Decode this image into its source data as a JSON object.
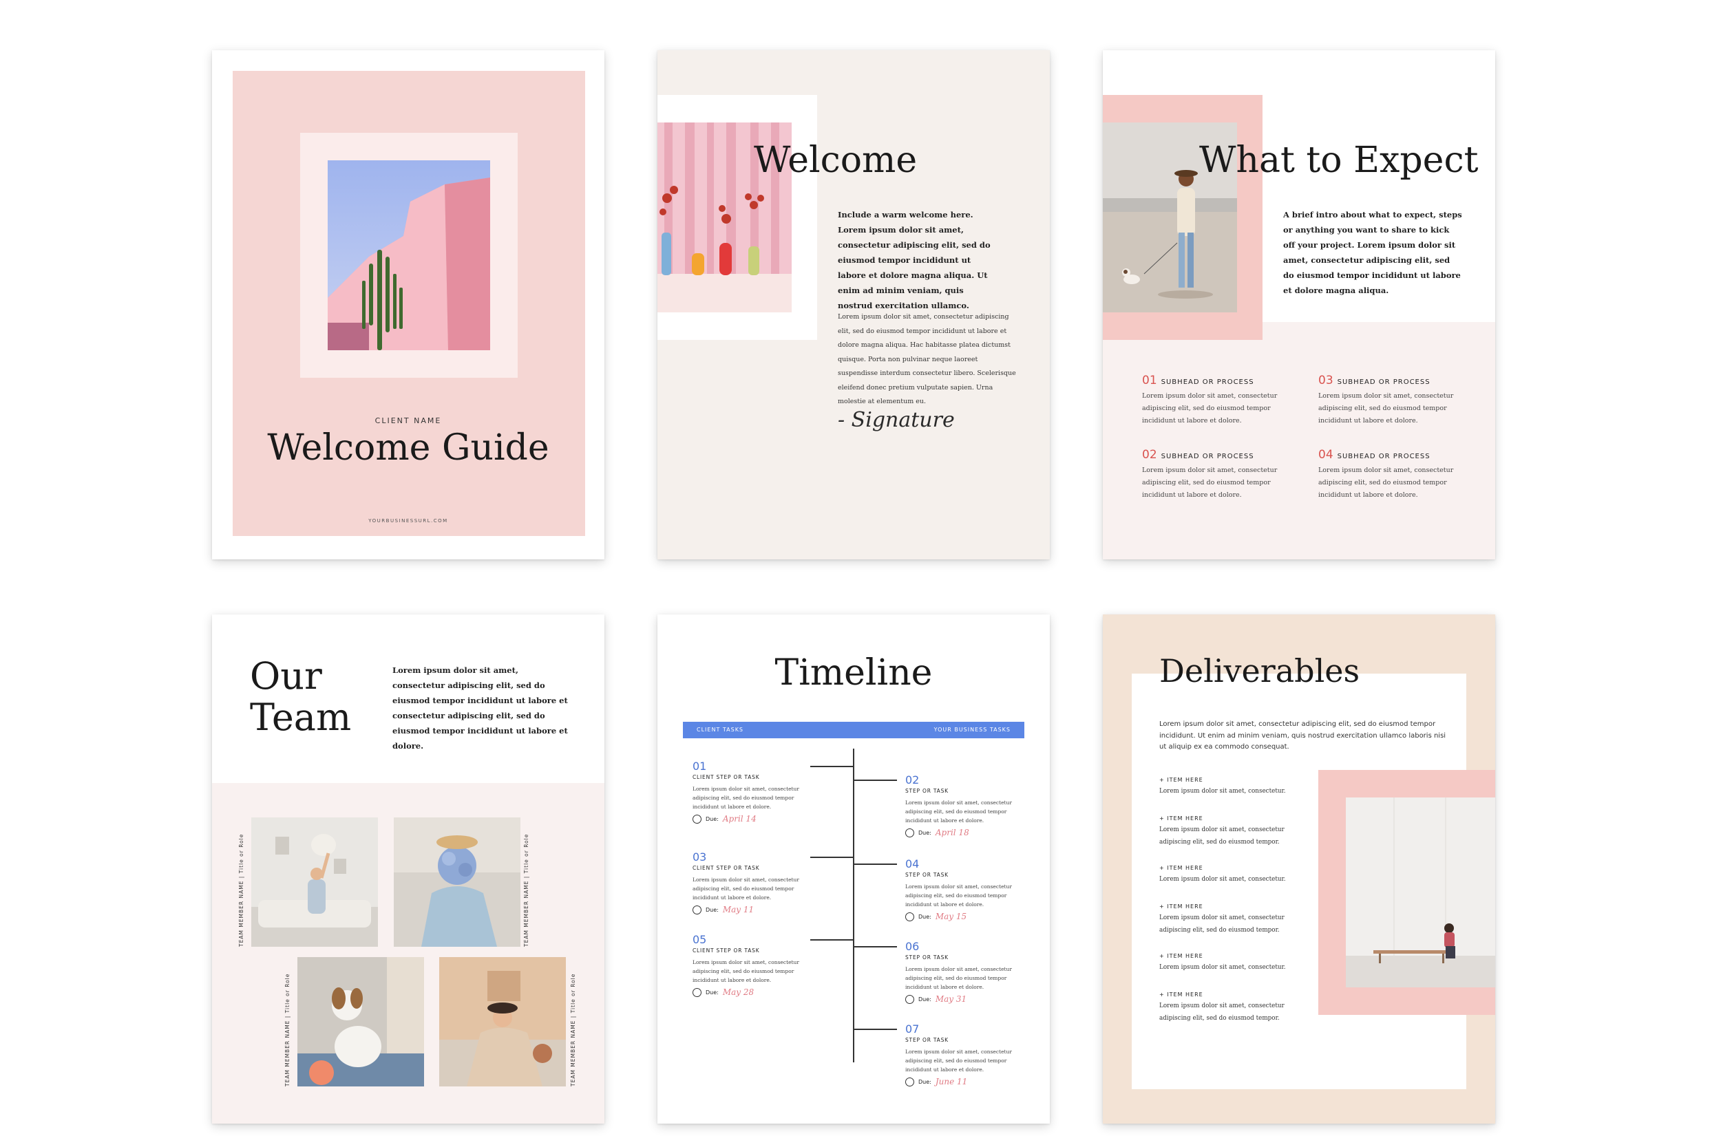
{
  "cover": {
    "client_label": "CLIENT NAME",
    "title": "Welcome Guide",
    "url": "YOURBUSINESSURL.COM"
  },
  "welcome": {
    "title": "Welcome",
    "intro": "Include a warm welcome here. Lorem ipsum dolor sit amet, consectetur adipiscing elit, sed do eiusmod tempor incididunt ut labore et dolore magna aliqua. Ut enim ad minim veniam, quis nostrud exercitation ullamco.",
    "body": "Lorem ipsum dolor sit amet, consectetur adipiscing elit, sed do eiusmod tempor incididunt ut labore et dolore magna aliqua. Hac habitasse platea dictumst quisque. Porta non pulvinar neque laoreet suspendisse interdum consectetur libero. Scelerisque eleifend donec pretium vulputate sapien. Urna molestie at elementum eu.",
    "signature": "- Signature"
  },
  "expect": {
    "title": "What to Expect",
    "intro": "A brief intro about what to expect, steps or anything you want to share to kick off your project. Lorem ipsum dolor sit amet, consectetur adipiscing elit, sed do eiusmod tempor incididunt ut labore et dolore magna aliqua.",
    "steps": [
      {
        "num": "01",
        "head": "SUBHEAD OR PROCESS",
        "text": "Lorem ipsum dolor sit amet, consectetur adipiscing elit, sed do eiusmod tempor incididunt ut labore et dolore."
      },
      {
        "num": "02",
        "head": "SUBHEAD OR PROCESS",
        "text": "Lorem ipsum dolor sit amet, consectetur adipiscing elit, sed do eiusmod tempor incididunt ut labore et dolore."
      },
      {
        "num": "03",
        "head": "SUBHEAD OR PROCESS",
        "text": "Lorem ipsum dolor sit amet, consectetur adipiscing elit, sed do eiusmod tempor incididunt ut labore et dolore."
      },
      {
        "num": "04",
        "head": "SUBHEAD OR PROCESS",
        "text": "Lorem ipsum dolor sit amet, consectetur adipiscing elit, sed do eiusmod tempor incididunt ut labore et dolore."
      }
    ]
  },
  "team": {
    "title_line1": "Our",
    "title_line2": "Team",
    "intro": "Lorem ipsum dolor sit amet, consectetur adipiscing elit, sed do eiusmod tempor incididunt ut labore et consectetur adipiscing elit, sed do eiusmod tempor incididunt ut labore et dolore.",
    "member_label": "TEAM MEMBER NAME  |  Title or Role"
  },
  "timeline": {
    "title": "Timeline",
    "left_header": "CLIENT TASKS",
    "right_header": "YOUR BUSINESS TASKS",
    "due_label": "Due:",
    "tasks": [
      {
        "num": "01",
        "head": "CLIENT STEP OR TASK",
        "text": "Lorem ipsum dolor sit amet, consectetur adipiscing elit, sed do eiusmod tempor incididunt ut labore et dolore.",
        "date": "April 14"
      },
      {
        "num": "02",
        "head": "STEP OR TASK",
        "text": "Lorem ipsum dolor sit amet, consectetur adipiscing elit, sed do eiusmod tempor incididunt ut labore et dolore.",
        "date": "April 18"
      },
      {
        "num": "03",
        "head": "CLIENT STEP OR TASK",
        "text": "Lorem ipsum dolor sit amet, consectetur adipiscing elit, sed do eiusmod tempor incididunt ut labore et dolore.",
        "date": "May 11"
      },
      {
        "num": "04",
        "head": "STEP OR TASK",
        "text": "Lorem ipsum dolor sit amet, consectetur adipiscing elit, sed do eiusmod tempor incididunt ut labore et dolore.",
        "date": "May 15"
      },
      {
        "num": "05",
        "head": "CLIENT STEP OR TASK",
        "text": "Lorem ipsum dolor sit amet, consectetur adipiscing elit, sed do eiusmod tempor incididunt ut labore et dolore.",
        "date": "May 28"
      },
      {
        "num": "06",
        "head": "STEP OR TASK",
        "text": "Lorem ipsum dolor sit amet, consectetur adipiscing elit, sed do eiusmod tempor incididunt ut labore et dolore.",
        "date": "May 31"
      },
      {
        "num": "07",
        "head": "STEP OR TASK",
        "text": "Lorem ipsum dolor sit amet, consectetur adipiscing elit, sed do eiusmod tempor incididunt ut labore et dolore.",
        "date": "June 11"
      }
    ]
  },
  "deliverables": {
    "title": "Deliverables",
    "intro": "Lorem ipsum dolor sit amet, consectetur adipiscing elit, sed do eiusmod tempor incididunt. Ut enim ad minim veniam, quis nostrud exercitation ullamco laboris nisi ut aliquip ex ea commodo consequat.",
    "items": [
      {
        "head": "+ ITEM HERE",
        "text": "Lorem ipsum dolor sit amet, consectetur."
      },
      {
        "head": "+ ITEM HERE",
        "text": "Lorem ipsum dolor sit amet, consectetur adipiscing elit, sed do eiusmod tempor."
      },
      {
        "head": "+ ITEM HERE",
        "text": "Lorem ipsum dolor sit amet, consectetur."
      },
      {
        "head": "+ ITEM HERE",
        "text": "Lorem ipsum dolor sit amet, consectetur adipiscing elit, sed do eiusmod tempor."
      },
      {
        "head": "+ ITEM HERE",
        "text": "Lorem ipsum dolor sit amet, consectetur."
      },
      {
        "head": "+ ITEM HERE",
        "text": "Lorem ipsum dolor sit amet, consectetur adipiscing elit, sed do eiusmod tempor."
      }
    ]
  },
  "colors": {
    "blush": "#f5d6d3",
    "pink_accent": "#f5c9c5",
    "cream": "#f5f0ec",
    "sand": "#f3e3d5",
    "timeline_blue": "#5b86e5",
    "number_red": "#d9534f"
  }
}
